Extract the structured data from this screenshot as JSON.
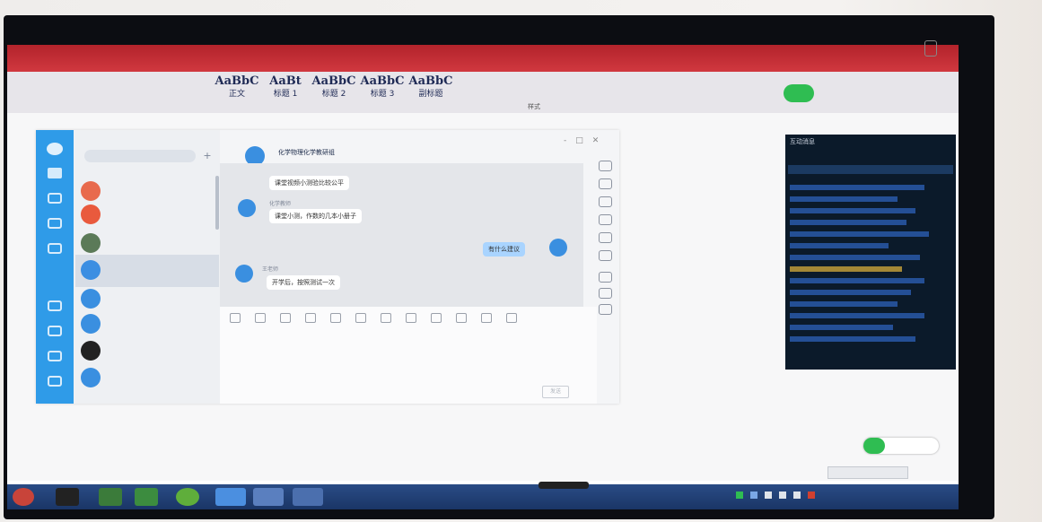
{
  "ribbon": {
    "styles": [
      {
        "sample": "AaBbC",
        "name": "正文"
      },
      {
        "sample": "AaBt",
        "name": "标题 1"
      },
      {
        "sample": "AaBbC",
        "name": "标题 2"
      },
      {
        "sample": "AaBbC",
        "name": "标题 3"
      },
      {
        "sample": "AaBbC",
        "name": "副标题"
      }
    ],
    "styles_group": "样式"
  },
  "qq": {
    "chat_title": "化学物理化学教研组",
    "messages": [
      {
        "text": "课堂视频小测验比较公平"
      },
      {
        "sender": "化学教师",
        "text": "课堂小测，作数的几本小册子"
      },
      {
        "text": "有什么建议",
        "mine": true
      },
      {
        "sender": "王老师",
        "text": "开学后，按照测试一次"
      }
    ],
    "send_label": "发送"
  },
  "danmu": {
    "title": "互动消息"
  }
}
